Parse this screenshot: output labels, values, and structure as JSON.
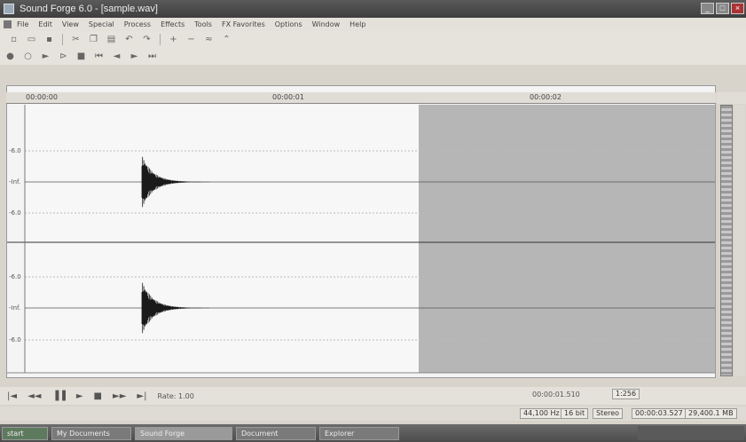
{
  "window": {
    "title": "Sound Forge 6.0 - [sample.wav]",
    "minimize_glyph": "_",
    "maximize_glyph": "□",
    "close_glyph": "×"
  },
  "menu": {
    "items": [
      "File",
      "Edit",
      "View",
      "Special",
      "Process",
      "Effects",
      "Tools",
      "FX Favorites",
      "Options",
      "Window",
      "Help"
    ]
  },
  "toolbar1": {
    "tools": [
      "new-icon",
      "open-icon",
      "save-icon",
      "cut-icon",
      "copy-icon",
      "paste-icon",
      "undo-icon",
      "redo-icon",
      "zoom-in-icon",
      "zoom-out-icon",
      "normalize-icon",
      "marker-icon"
    ]
  },
  "toolbar2": {
    "tools": [
      "record-icon",
      "loop-icon",
      "play-icon",
      "play-all-icon",
      "stop-icon",
      "go-start-icon",
      "rewind-icon",
      "forward-icon",
      "go-end-icon"
    ]
  },
  "ruler": {
    "marks": [
      "00:00:00",
      "00:00:01",
      "00:00:02"
    ]
  },
  "channels": {
    "amp_labels_top": [
      "-6.0",
      "-Inf.",
      "-6.0"
    ],
    "amp_labels_bottom": [
      "-6.0",
      "-Inf.",
      "-6.0"
    ]
  },
  "transport": {
    "buttons": [
      "|◄",
      "◄◄",
      "▐▐",
      "►",
      "■",
      "►►",
      "►|"
    ],
    "rate_label": "Rate: 1.00",
    "time_readout": "00:00:01.510"
  },
  "status": {
    "zoom": "1:256",
    "sample_rate": "44,100 Hz",
    "bit_depth": "16 bit",
    "channels": "Stereo",
    "length": "00:00:03.527",
    "free_space": "29,400.1 MB"
  },
  "taskbar": {
    "start_label": "start",
    "tasks": [
      "My Documents",
      "Sound Forge",
      "Document",
      "Explorer"
    ]
  },
  "colors": {
    "selection": "#b4b4b4",
    "waveform": "#1a1a1a",
    "background": "#f6f6f6"
  }
}
